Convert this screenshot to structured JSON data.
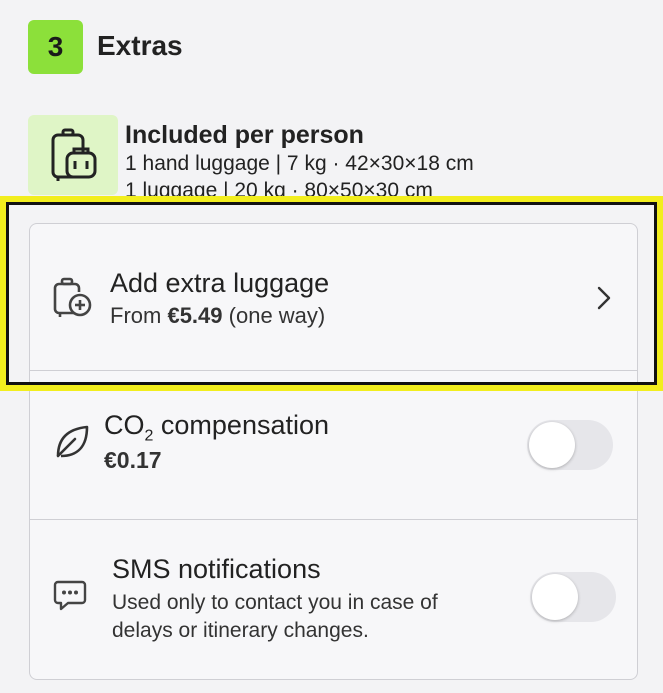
{
  "section": {
    "step_number": "3",
    "title": "Extras"
  },
  "included": {
    "icon": "luggage-icon",
    "title": "Included per person",
    "hand_luggage": "1 hand luggage | 7 kg · 42×30×18 cm",
    "checked_luggage": "1 luggage | 20 kg · 80×50×30 cm"
  },
  "extra_luggage": {
    "icon": "add-luggage-icon",
    "title": "Add extra luggage",
    "price_prefix": "From",
    "price": "€5.49",
    "price_suffix": "(one way)"
  },
  "co2": {
    "icon": "leaf-icon",
    "title_prefix": "CO",
    "title_subscript": "2",
    "title_suffix": " compensation",
    "price": "€0.17",
    "toggle_on": false
  },
  "sms": {
    "icon": "chat-bubble-icon",
    "title": "SMS notifications",
    "description_line1": "Used only to contact you in case of",
    "description_line2": "delays or itinerary changes.",
    "toggle_on": false
  },
  "colors": {
    "accent_green": "#8ce03a",
    "light_green": "#dff5c6",
    "highlight_yellow": "#f2ee1e"
  }
}
